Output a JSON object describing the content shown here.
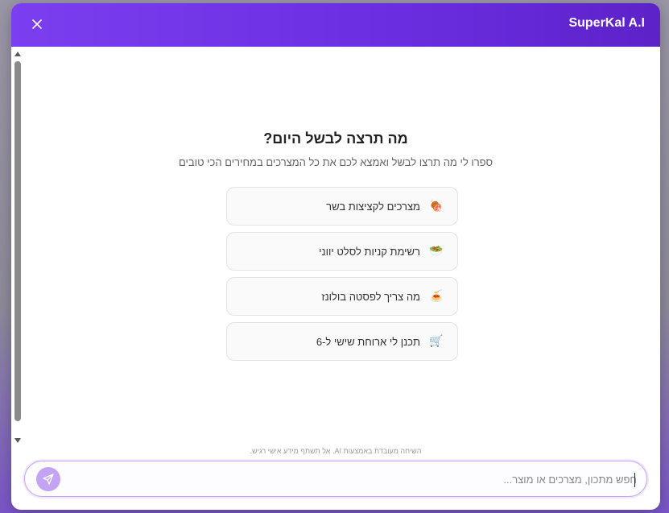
{
  "header": {
    "brand": "SuperKal A.I",
    "close_icon": "close-icon",
    "gradient_colors": [
      "#7b3ff0",
      "#5d22c8"
    ]
  },
  "main": {
    "title": "מה תרצה לבשל היום?",
    "subtitle": "ספרו לי מה תרצו לבשל ואמצא לכם את כל המצרכים במחירים הכי טובים",
    "suggestions": [
      {
        "emoji": "🍖",
        "icon": "meat-icon",
        "label": "מצרכים לקציצות בשר"
      },
      {
        "emoji": "🥗",
        "icon": "salad-icon",
        "label": "רשימת קניות לסלט יווני"
      },
      {
        "emoji": "🍝",
        "icon": "pasta-icon",
        "label": "מה צריך לפסטה בולונז"
      },
      {
        "emoji": "🛒",
        "icon": "cart-icon",
        "label": "תכנן לי ארוחת שישי ל-6"
      }
    ]
  },
  "footer": {
    "disclaimer": "השיחה מעובדת באמצעות AI. אל תשתף מידע אישי רגיש.",
    "input_placeholder": "חפש מתכון, מצרכים או מוצר...",
    "input_value": "",
    "send_icon": "send-icon",
    "accent_color": "#c3a3f3"
  }
}
